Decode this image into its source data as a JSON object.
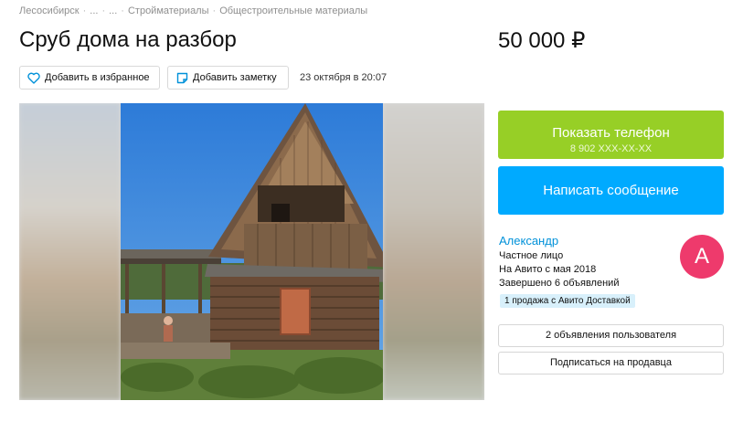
{
  "breadcrumbs": [
    "Лесосибирск",
    "...",
    "...",
    "Стройматериалы",
    "Общестроительные материалы"
  ],
  "ad": {
    "title": "Сруб дома на разбор",
    "price": "50 000 ₽",
    "date": "23 октября в 20:07"
  },
  "actions": {
    "favorite_label": "Добавить в избранное",
    "note_label": "Добавить заметку"
  },
  "contact": {
    "show_phone_label": "Показать телефон",
    "phone_masked": "8 902 XXX-XX-XX",
    "message_label": "Написать сообщение"
  },
  "seller": {
    "name": "Александр",
    "type": "Частное лицо",
    "since": "На Авито с мая 2018",
    "completed": "Завершено 6 объявлений",
    "delivery_badge": "1 продажа с Авито Доставкой",
    "avatar_letter": "А",
    "avatar_color": "#ee3a6c",
    "listings_label": "2 объявления пользователя",
    "subscribe_label": "Подписаться на продавца"
  },
  "colors": {
    "phone_button": "#97cf26",
    "message_button": "#00aaff",
    "link": "#0091d9"
  },
  "icons": {
    "favorite": "heart-icon",
    "note": "note-icon"
  }
}
